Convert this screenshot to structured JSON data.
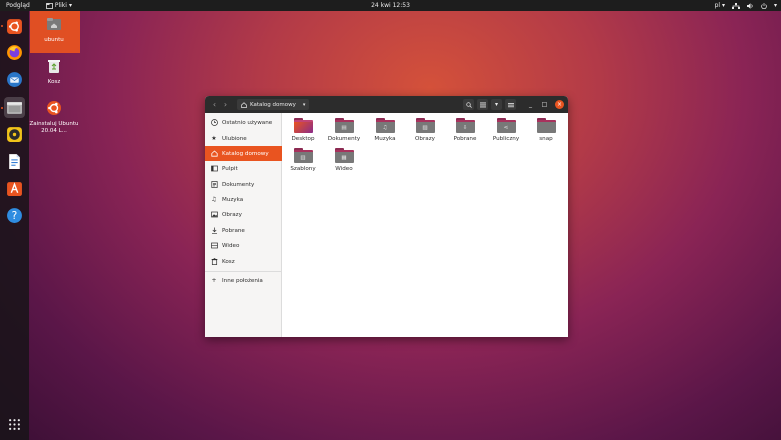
{
  "topbar": {
    "activities": "Podgląd",
    "app_menu": "Pliki",
    "clock": "24 kwi  12:53",
    "keyboard": "pl"
  },
  "dock": {
    "items": [
      {
        "name": "Instalator Ubuntu",
        "icon": "ubuntu-installer-icon",
        "color": "#e95420"
      },
      {
        "name": "Firefox",
        "icon": "firefox-icon",
        "color": "#ff9500"
      },
      {
        "name": "Thunderbird",
        "icon": "thunderbird-icon",
        "color": "#2a76c9"
      },
      {
        "name": "Pliki",
        "icon": "files-icon",
        "color": "#8e8e8e",
        "active": true
      },
      {
        "name": "Rhythmbox",
        "icon": "rhythmbox-icon",
        "color": "#f1c31a"
      },
      {
        "name": "LibreOffice Writer",
        "icon": "writer-icon",
        "color": "#2f7bd5"
      },
      {
        "name": "Ubuntu Software",
        "icon": "software-icon",
        "color": "#e95420"
      },
      {
        "name": "Pomoc",
        "icon": "help-icon",
        "color": "#2f8ce0"
      }
    ],
    "apps_grid": "show-apps-icon"
  },
  "desktop": {
    "icons": [
      {
        "label": "ubuntu",
        "icon": "home-folder-icon"
      },
      {
        "label": "Kosz",
        "icon": "trash-icon"
      },
      {
        "label": "Zainstaluj Ubuntu 20.04 L...",
        "icon": "install-ubuntu-icon"
      }
    ]
  },
  "window": {
    "path": "Katalog domowy",
    "toolbar": {
      "search": "search-icon",
      "view": "list-view-icon",
      "view_menu": "chevron-down-icon",
      "menu": "hamburger-menu-icon",
      "minimize": "_",
      "maximize": "□",
      "close": "×"
    },
    "sidebar": [
      {
        "label": "Ostatnio używane",
        "icon": "clock-icon"
      },
      {
        "label": "Ulubione",
        "icon": "star-icon"
      },
      {
        "label": "Katalog domowy",
        "icon": "home-icon",
        "active": true
      },
      {
        "label": "Pulpit",
        "icon": "desktop-icon"
      },
      {
        "label": "Dokumenty",
        "icon": "document-icon"
      },
      {
        "label": "Muzyka",
        "icon": "music-icon"
      },
      {
        "label": "Obrazy",
        "icon": "image-icon"
      },
      {
        "label": "Pobrane",
        "icon": "download-icon"
      },
      {
        "label": "Wideo",
        "icon": "video-icon"
      },
      {
        "label": "Kosz",
        "icon": "trash-icon"
      },
      {
        "label": "Inne położenia",
        "icon": "plus-icon"
      }
    ],
    "files": [
      {
        "label": "Desktop",
        "icon": "desktop-folder-icon"
      },
      {
        "label": "Dokumenty",
        "icon": "documents-folder-icon"
      },
      {
        "label": "Muzyka",
        "icon": "music-folder-icon"
      },
      {
        "label": "Obrazy",
        "icon": "pictures-folder-icon"
      },
      {
        "label": "Pobrane",
        "icon": "downloads-folder-icon"
      },
      {
        "label": "Publiczny",
        "icon": "public-folder-icon"
      },
      {
        "label": "snap",
        "icon": "folder-icon"
      },
      {
        "label": "Szablony",
        "icon": "templates-folder-icon"
      },
      {
        "label": "Wideo",
        "icon": "videos-folder-icon"
      }
    ]
  },
  "colors": {
    "accent": "#e95420",
    "headerbar": "#2c2c2c",
    "sidebar": "#f6f5f4",
    "folder": "#787878",
    "folder_tab": "#a8325d"
  }
}
